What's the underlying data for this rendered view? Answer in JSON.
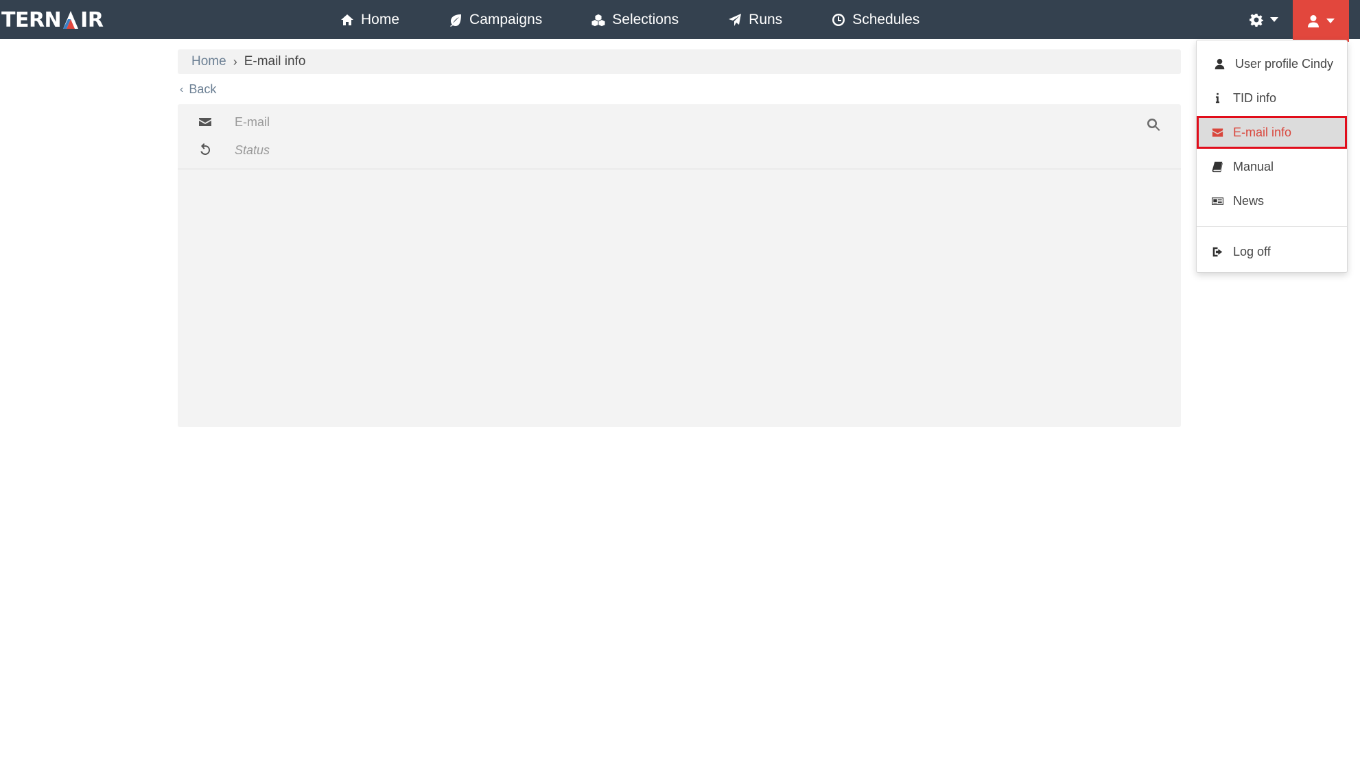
{
  "brand": {
    "logo_left": "TERN",
    "logo_right": "IR"
  },
  "nav": {
    "items": [
      {
        "label": "Home",
        "icon": "home-icon"
      },
      {
        "label": "Campaigns",
        "icon": "leaf-icon"
      },
      {
        "label": "Selections",
        "icon": "cubes-icon"
      },
      {
        "label": "Runs",
        "icon": "paper-plane-icon"
      },
      {
        "label": "Schedules",
        "icon": "clock-icon"
      }
    ],
    "settings_icon": "gear-icon",
    "user_icon": "user-icon"
  },
  "breadcrumb": {
    "home": "Home",
    "separator": "›",
    "current": "E-mail info"
  },
  "back": {
    "label": "Back"
  },
  "filters": {
    "email_placeholder": "E-mail",
    "status_placeholder": "Status"
  },
  "user_menu": {
    "items": [
      {
        "label": "User profile Cindy",
        "icon": "user-icon"
      },
      {
        "label": "TID info",
        "icon": "info-icon"
      },
      {
        "label": "E-mail info",
        "icon": "envelope-icon",
        "active": true
      },
      {
        "label": "Manual",
        "icon": "book-icon"
      },
      {
        "label": "News",
        "icon": "newspaper-icon"
      },
      {
        "label": "Log off",
        "icon": "sign-out-icon"
      }
    ]
  },
  "colors": {
    "navbar": "#34414f",
    "accent": "#e2473d",
    "active_text": "#d9463c",
    "highlight_outline": "#e10d1b",
    "link": "#6b7f93"
  }
}
